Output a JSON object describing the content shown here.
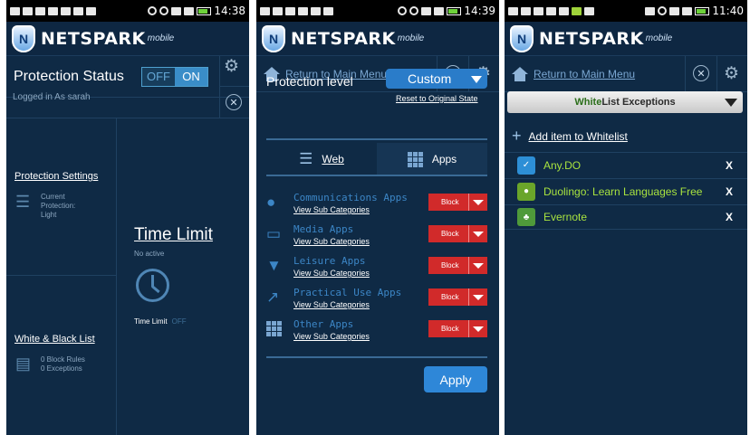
{
  "brand": {
    "name": "NETSPARK",
    "suffix": "mobile",
    "shield_letter": "N"
  },
  "screen1": {
    "status": {
      "time": "14:38"
    },
    "header": {
      "title": "Protection Status",
      "toggle_off": "OFF",
      "toggle_on": "ON",
      "logged_in": "Logged in As sarah"
    },
    "protection_settings": {
      "title": "Protection Settings",
      "desc_1": "Current",
      "desc_2": "Protection:",
      "desc_3": "Light"
    },
    "white_black": {
      "title": "White & Black List",
      "rules": "0 Block Rules",
      "exceptions": "0 Exceptions"
    },
    "time_limit": {
      "title": "Time Limit",
      "status": "No active",
      "label": "Time Limit",
      "state": "OFF"
    }
  },
  "screen2": {
    "status": {
      "time": "14:39"
    },
    "nav": {
      "return_label": "Return to Main Menu"
    },
    "protection_level": {
      "label": "Protection level",
      "value": "Custom",
      "reset": "Reset to Original State"
    },
    "tabs": {
      "web": "Web",
      "apps": "Apps"
    },
    "categories": [
      {
        "name": "Communications Apps",
        "sub": "View Sub Categories",
        "action": "Block"
      },
      {
        "name": "Media Apps",
        "sub": "View Sub Categories",
        "action": "Block"
      },
      {
        "name": "Leisure Apps",
        "sub": "View Sub Categories",
        "action": "Block"
      },
      {
        "name": "Practical Use Apps",
        "sub": "View Sub Categories",
        "action": "Block"
      },
      {
        "name": "Other Apps",
        "sub": "View Sub Categories",
        "action": "Block"
      }
    ],
    "apply": "Apply"
  },
  "screen3": {
    "status": {
      "time": "11:40"
    },
    "nav": {
      "return_label": "Return to Main Menu"
    },
    "list_selector": {
      "prefix": "White",
      "rest": " List Exceptions"
    },
    "add_item": "Add item to Whitelist",
    "items": [
      {
        "name": "Any.DO",
        "remove": "X",
        "icon": "anydo-icon",
        "color": "#2d8fd6"
      },
      {
        "name": "Duolingo: Learn Languages Free",
        "remove": "X",
        "icon": "duolingo-icon",
        "color": "#6aa52a"
      },
      {
        "name": "Evernote",
        "remove": "X",
        "icon": "evernote-icon",
        "color": "#4f9a3a"
      }
    ]
  },
  "colors": {
    "background": "#0f2a45",
    "accent": "#2e87d8",
    "block": "#d12a2a",
    "app_name": "#a9e43f"
  }
}
